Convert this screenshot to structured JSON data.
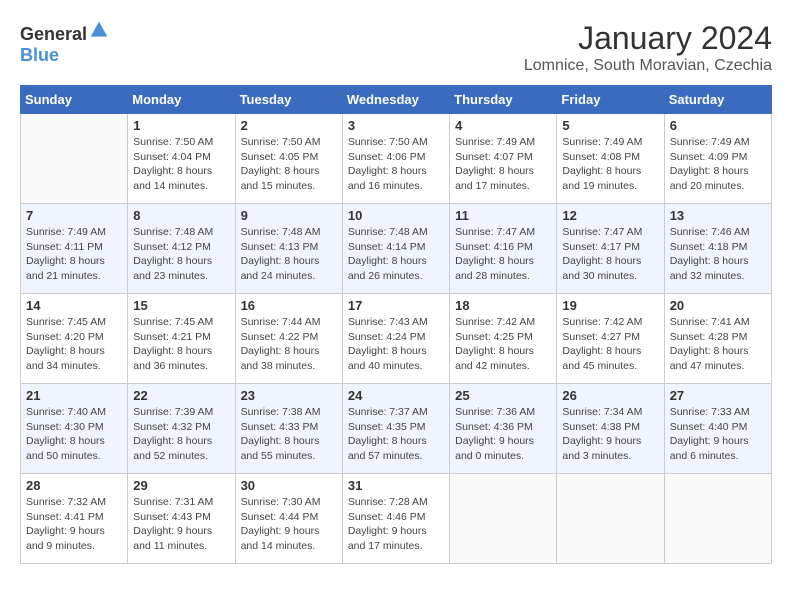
{
  "header": {
    "logo_general": "General",
    "logo_blue": "Blue",
    "month": "January 2024",
    "location": "Lomnice, South Moravian, Czechia"
  },
  "days_of_week": [
    "Sunday",
    "Monday",
    "Tuesday",
    "Wednesday",
    "Thursday",
    "Friday",
    "Saturday"
  ],
  "weeks": [
    [
      {
        "day": "",
        "info": ""
      },
      {
        "day": "1",
        "info": "Sunrise: 7:50 AM\nSunset: 4:04 PM\nDaylight: 8 hours\nand 14 minutes."
      },
      {
        "day": "2",
        "info": "Sunrise: 7:50 AM\nSunset: 4:05 PM\nDaylight: 8 hours\nand 15 minutes."
      },
      {
        "day": "3",
        "info": "Sunrise: 7:50 AM\nSunset: 4:06 PM\nDaylight: 8 hours\nand 16 minutes."
      },
      {
        "day": "4",
        "info": "Sunrise: 7:49 AM\nSunset: 4:07 PM\nDaylight: 8 hours\nand 17 minutes."
      },
      {
        "day": "5",
        "info": "Sunrise: 7:49 AM\nSunset: 4:08 PM\nDaylight: 8 hours\nand 19 minutes."
      },
      {
        "day": "6",
        "info": "Sunrise: 7:49 AM\nSunset: 4:09 PM\nDaylight: 8 hours\nand 20 minutes."
      }
    ],
    [
      {
        "day": "7",
        "info": ""
      },
      {
        "day": "8",
        "info": "Sunrise: 7:48 AM\nSunset: 4:12 PM\nDaylight: 8 hours\nand 23 minutes."
      },
      {
        "day": "9",
        "info": "Sunrise: 7:48 AM\nSunset: 4:13 PM\nDaylight: 8 hours\nand 24 minutes."
      },
      {
        "day": "10",
        "info": "Sunrise: 7:48 AM\nSunset: 4:14 PM\nDaylight: 8 hours\nand 26 minutes."
      },
      {
        "day": "11",
        "info": "Sunrise: 7:47 AM\nSunset: 4:16 PM\nDaylight: 8 hours\nand 28 minutes."
      },
      {
        "day": "12",
        "info": "Sunrise: 7:47 AM\nSunset: 4:17 PM\nDaylight: 8 hours\nand 30 minutes."
      },
      {
        "day": "13",
        "info": "Sunrise: 7:46 AM\nSunset: 4:18 PM\nDaylight: 8 hours\nand 32 minutes."
      }
    ],
    [
      {
        "day": "14",
        "info": ""
      },
      {
        "day": "15",
        "info": "Sunrise: 7:45 AM\nSunset: 4:21 PM\nDaylight: 8 hours\nand 36 minutes."
      },
      {
        "day": "16",
        "info": "Sunrise: 7:44 AM\nSunset: 4:22 PM\nDaylight: 8 hours\nand 38 minutes."
      },
      {
        "day": "17",
        "info": "Sunrise: 7:43 AM\nSunset: 4:24 PM\nDaylight: 8 hours\nand 40 minutes."
      },
      {
        "day": "18",
        "info": "Sunrise: 7:42 AM\nSunset: 4:25 PM\nDaylight: 8 hours\nand 42 minutes."
      },
      {
        "day": "19",
        "info": "Sunrise: 7:42 AM\nSunset: 4:27 PM\nDaylight: 8 hours\nand 45 minutes."
      },
      {
        "day": "20",
        "info": "Sunrise: 7:41 AM\nSunset: 4:28 PM\nDaylight: 8 hours\nand 47 minutes."
      }
    ],
    [
      {
        "day": "21",
        "info": ""
      },
      {
        "day": "22",
        "info": "Sunrise: 7:39 AM\nSunset: 4:32 PM\nDaylight: 8 hours\nand 52 minutes."
      },
      {
        "day": "23",
        "info": "Sunrise: 7:38 AM\nSunset: 4:33 PM\nDaylight: 8 hours\nand 55 minutes."
      },
      {
        "day": "24",
        "info": "Sunrise: 7:37 AM\nSunset: 4:35 PM\nDaylight: 8 hours\nand 57 minutes."
      },
      {
        "day": "25",
        "info": "Sunrise: 7:36 AM\nSunset: 4:36 PM\nDaylight: 9 hours\nand 0 minutes."
      },
      {
        "day": "26",
        "info": "Sunrise: 7:34 AM\nSunset: 4:38 PM\nDaylight: 9 hours\nand 3 minutes."
      },
      {
        "day": "27",
        "info": "Sunrise: 7:33 AM\nSunset: 4:40 PM\nDaylight: 9 hours\nand 6 minutes."
      }
    ],
    [
      {
        "day": "28",
        "info": "Sunrise: 7:32 AM\nSunset: 4:41 PM\nDaylight: 9 hours\nand 9 minutes."
      },
      {
        "day": "29",
        "info": "Sunrise: 7:31 AM\nSunset: 4:43 PM\nDaylight: 9 hours\nand 11 minutes."
      },
      {
        "day": "30",
        "info": "Sunrise: 7:30 AM\nSunset: 4:44 PM\nDaylight: 9 hours\nand 14 minutes."
      },
      {
        "day": "31",
        "info": "Sunrise: 7:28 AM\nSunset: 4:46 PM\nDaylight: 9 hours\nand 17 minutes."
      },
      {
        "day": "",
        "info": ""
      },
      {
        "day": "",
        "info": ""
      },
      {
        "day": "",
        "info": ""
      }
    ]
  ],
  "week7_sunday": "Sunrise: 7:49 AM\nSunset: 4:11 PM\nDaylight: 8 hours\nand 21 minutes.",
  "week14_sunday": "Sunrise: 7:45 AM\nSunset: 4:20 PM\nDaylight: 8 hours\nand 34 minutes.",
  "week21_sunday": "Sunrise: 7:40 AM\nSunset: 4:30 PM\nDaylight: 8 hours\nand 50 minutes."
}
